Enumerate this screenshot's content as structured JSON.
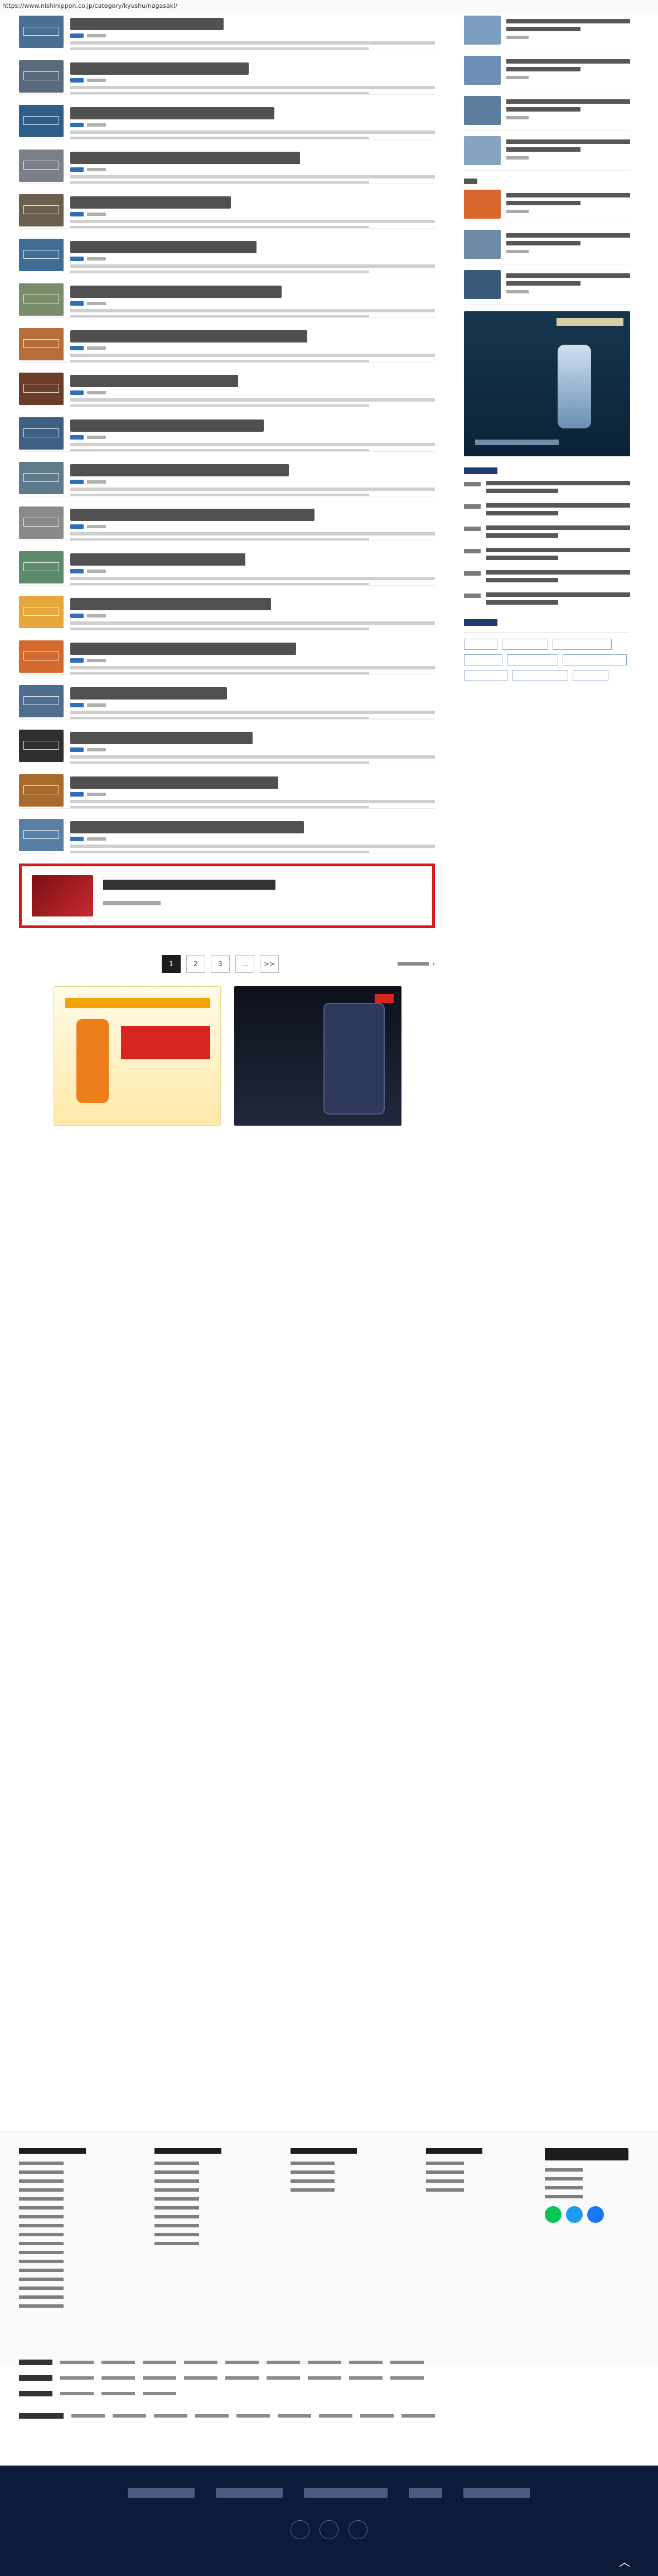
{
  "browser": {
    "url": "https://www.nishinippon.co.jp/category/kyushu/nagasaki/"
  },
  "main": {
    "articles": [
      {
        "thumb_color": "#4a6f92"
      },
      {
        "thumb_color": "#5a6a7c"
      },
      {
        "thumb_color": "#2e5f8a"
      },
      {
        "thumb_color": "#7a7f88"
      },
      {
        "thumb_color": "#6a5f4f"
      },
      {
        "thumb_color": "#3f6d95"
      },
      {
        "thumb_color": "#7a8d6b"
      },
      {
        "thumb_color": "#b76d39"
      },
      {
        "thumb_color": "#6b3c2a"
      },
      {
        "thumb_color": "#3e6083"
      },
      {
        "thumb_color": "#5f7a8a"
      },
      {
        "thumb_color": "#8a8a8a"
      },
      {
        "thumb_color": "#5c8a6a"
      },
      {
        "thumb_color": "#e6a73b"
      },
      {
        "thumb_color": "#d4692d"
      },
      {
        "thumb_color": "#4e6d8f"
      },
      {
        "thumb_color": "#2f2f2f"
      },
      {
        "thumb_color": "#a86b2d"
      },
      {
        "thumb_color": "#5a7fa4"
      }
    ],
    "promo": {},
    "pager": {
      "pages": [
        "1",
        "2",
        "3",
        "…",
        ">>"
      ],
      "active": "1"
    }
  },
  "sidebar": {
    "top_articles": [
      {
        "thumb_color": "#7b9dc0"
      },
      {
        "thumb_color": "#6d8fb5"
      },
      {
        "thumb_color": "#5d7d9f"
      },
      {
        "thumb_color": "#86a4c2"
      }
    ],
    "pr_articles": [
      {
        "thumb_color": "#d7672c"
      },
      {
        "thumb_color": "#6f8aa8"
      },
      {
        "thumb_color": "#3a5a7a"
      }
    ],
    "news_count": 6,
    "tags_count": 9
  },
  "footer": {
    "colors": {
      "dark": "#0d1b3a",
      "social_line": "#06c755",
      "social_twitter": "#1d9bf0",
      "social_facebook": "#1877f2"
    }
  },
  "colors": {
    "accent_red": "#d71920",
    "category_blue": "#2e6fb7",
    "tag_blue": "#8aa6cf",
    "section_navy": "#1c3b6e"
  }
}
